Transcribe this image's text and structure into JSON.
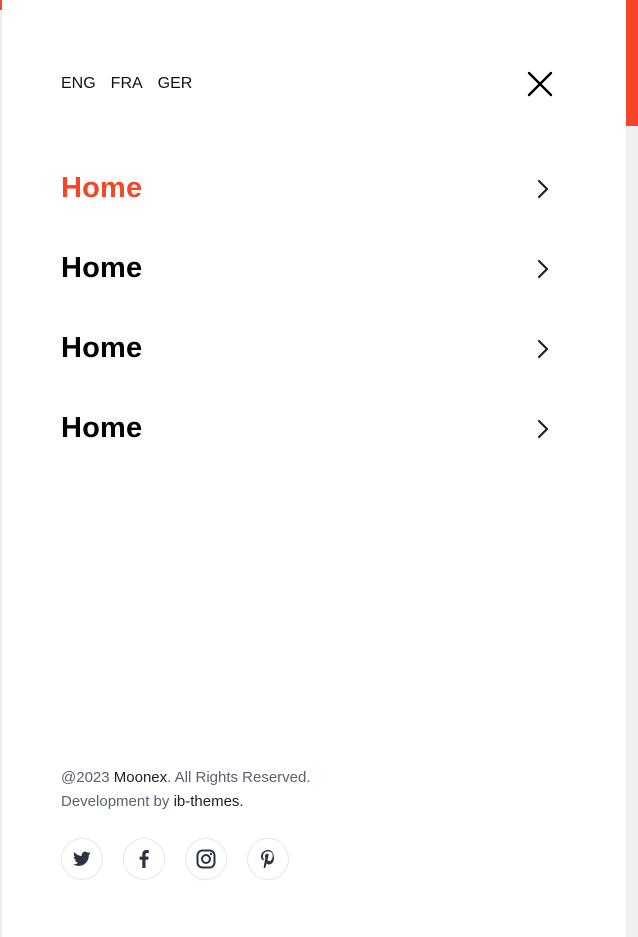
{
  "colors": {
    "accent": "#f4472a",
    "text": "#000000",
    "muted": "#5a6170",
    "icon": "#2b3340"
  },
  "languages": [
    "ENG",
    "FRA",
    "GER"
  ],
  "close_icon": "close-icon",
  "nav": {
    "items": [
      {
        "label": "Home",
        "active": true
      },
      {
        "label": "Home",
        "active": false
      },
      {
        "label": "Home",
        "active": false
      },
      {
        "label": "Home",
        "active": false
      }
    ],
    "chevron_icon": "chevron-right-icon"
  },
  "footer": {
    "copyright_prefix": "@2023 ",
    "brand": "Moonex",
    "rights": ". All Rights Reserved.",
    "dev_prefix": "Development by ",
    "dev_link": "ib-themes."
  },
  "socials": [
    {
      "icon": "twitter-icon"
    },
    {
      "icon": "facebook-icon"
    },
    {
      "icon": "instagram-icon"
    },
    {
      "icon": "pinterest-icon"
    }
  ]
}
